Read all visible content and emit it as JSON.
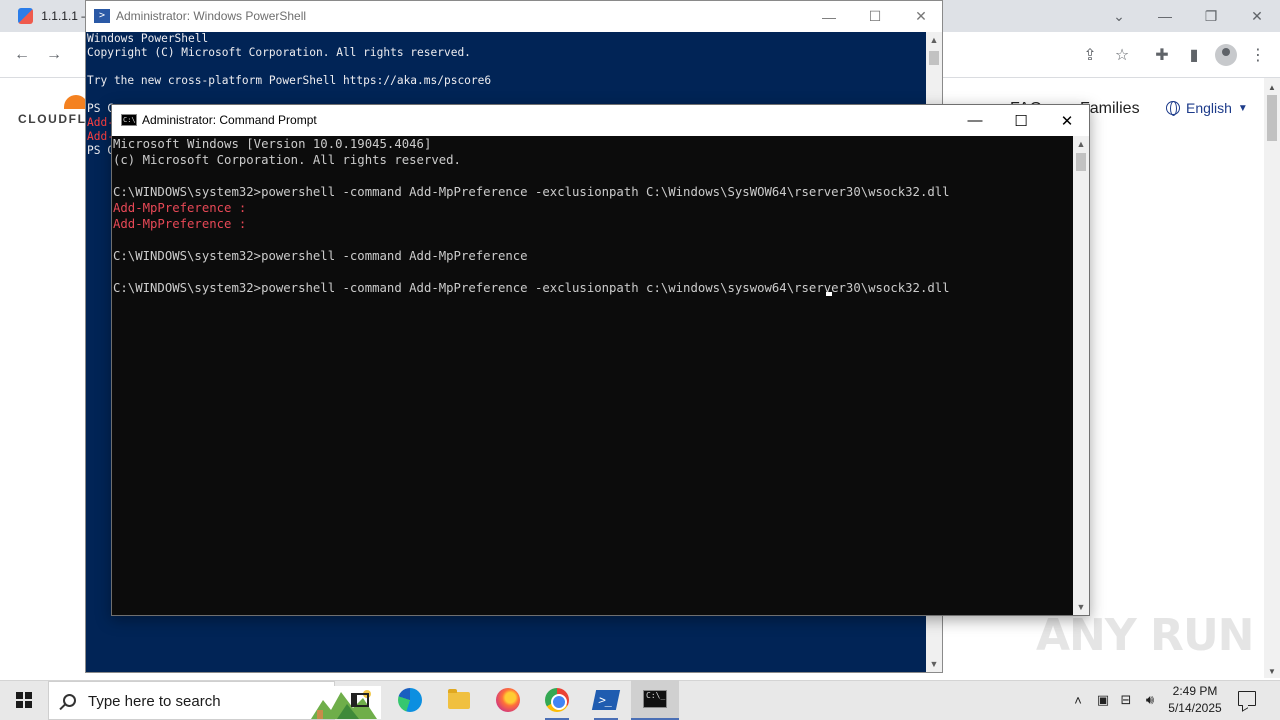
{
  "browser": {
    "tab_title": "1.1.1.1 –",
    "site_logo": "CLOUDFLA",
    "nav_faq": "FAQ",
    "nav_families": "Families",
    "language": "English"
  },
  "powershell": {
    "title": "Administrator: Windows PowerShell",
    "lines": [
      "Windows PowerShell",
      "Copyright (C) Microsoft Corporation. All rights reserved.",
      "",
      "Try the new cross-platform PowerShell https://aka.ms/pscore6",
      "",
      "PS C",
      "Add-",
      "Add-",
      "PS C"
    ]
  },
  "cmd": {
    "title": "Administrator: Command Prompt",
    "lines": [
      "Microsoft Windows [Version 10.0.19045.4046]",
      "(c) Microsoft Corporation. All rights reserved.",
      "",
      "C:\\WINDOWS\\system32>powershell -command Add-MpPreference -exclusionpath C:\\Windows\\SysWOW64\\rserver30\\wsock32.dll",
      "Add-MpPreference :",
      "Add-MpPreference :",
      "",
      "C:\\WINDOWS\\system32>powershell -command Add-MpPreference",
      "",
      "C:\\WINDOWS\\system32>powershell -command Add-MpPreference -exclusionpath c:\\windows\\syswow64\\rserver30\\wsock32.dll"
    ]
  },
  "taskbar": {
    "search_placeholder": "Type here to search",
    "time": "2:49 PM",
    "date": "5/14/2025"
  },
  "watermark": "ANY RUN"
}
